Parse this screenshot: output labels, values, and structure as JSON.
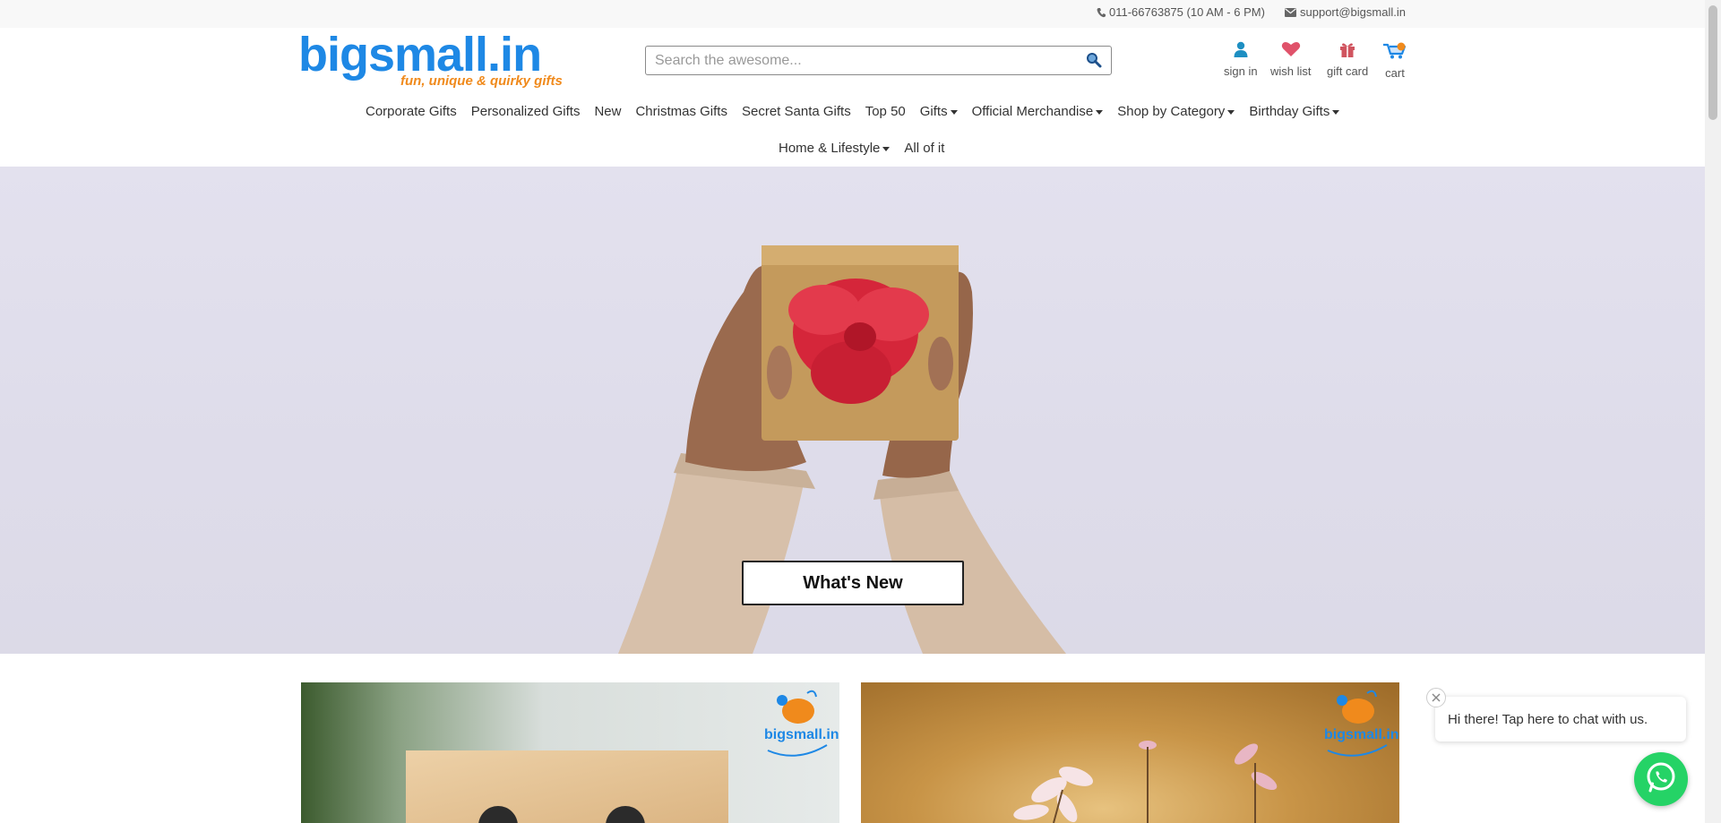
{
  "topbar": {
    "phone": "011-66763875 (10 AM - 6 PM)",
    "email": "support@bigsmall.in",
    "phone_icon": "phone-icon",
    "email_icon": "envelope-icon"
  },
  "header": {
    "logo_text": "bigsmall.in",
    "logo_tagline": "fun, unique & quirky gifts",
    "search_placeholder": "Search the awesome...",
    "search_value": "",
    "icons": [
      {
        "label": "sign in",
        "icon": "user-icon"
      },
      {
        "label": "wish list",
        "icon": "heart-icon"
      },
      {
        "label": "gift card",
        "icon": "gift-icon"
      },
      {
        "label": "cart",
        "icon": "cart-icon"
      }
    ]
  },
  "nav": {
    "row1": [
      {
        "label": "Corporate Gifts",
        "dropdown": false
      },
      {
        "label": "Personalized Gifts",
        "dropdown": false
      },
      {
        "label": "New",
        "dropdown": false
      },
      {
        "label": "Christmas Gifts",
        "dropdown": false
      },
      {
        "label": "Secret Santa Gifts",
        "dropdown": false
      },
      {
        "label": "Top 50",
        "dropdown": false
      },
      {
        "label": "Gifts",
        "dropdown": true
      },
      {
        "label": "Official Merchandise",
        "dropdown": true
      },
      {
        "label": "Shop by Category",
        "dropdown": true
      },
      {
        "label": "Birthday Gifts",
        "dropdown": true
      }
    ],
    "row2": [
      {
        "label": "Home & Lifestyle",
        "dropdown": true
      },
      {
        "label": "All of it",
        "dropdown": false
      }
    ]
  },
  "hero": {
    "button_label": "What's New"
  },
  "cards": {
    "mini_logo_text": "bigsmall.in"
  },
  "chat": {
    "bubble_text": "Hi there! Tap here to chat with us.",
    "close_icon": "close-icon",
    "whatsapp_icon": "whatsapp-icon"
  },
  "colors": {
    "brand_blue": "#1e88e5",
    "brand_orange": "#f08a1c",
    "whatsapp_green": "#25d366",
    "wishlist_red": "#e0526a"
  }
}
